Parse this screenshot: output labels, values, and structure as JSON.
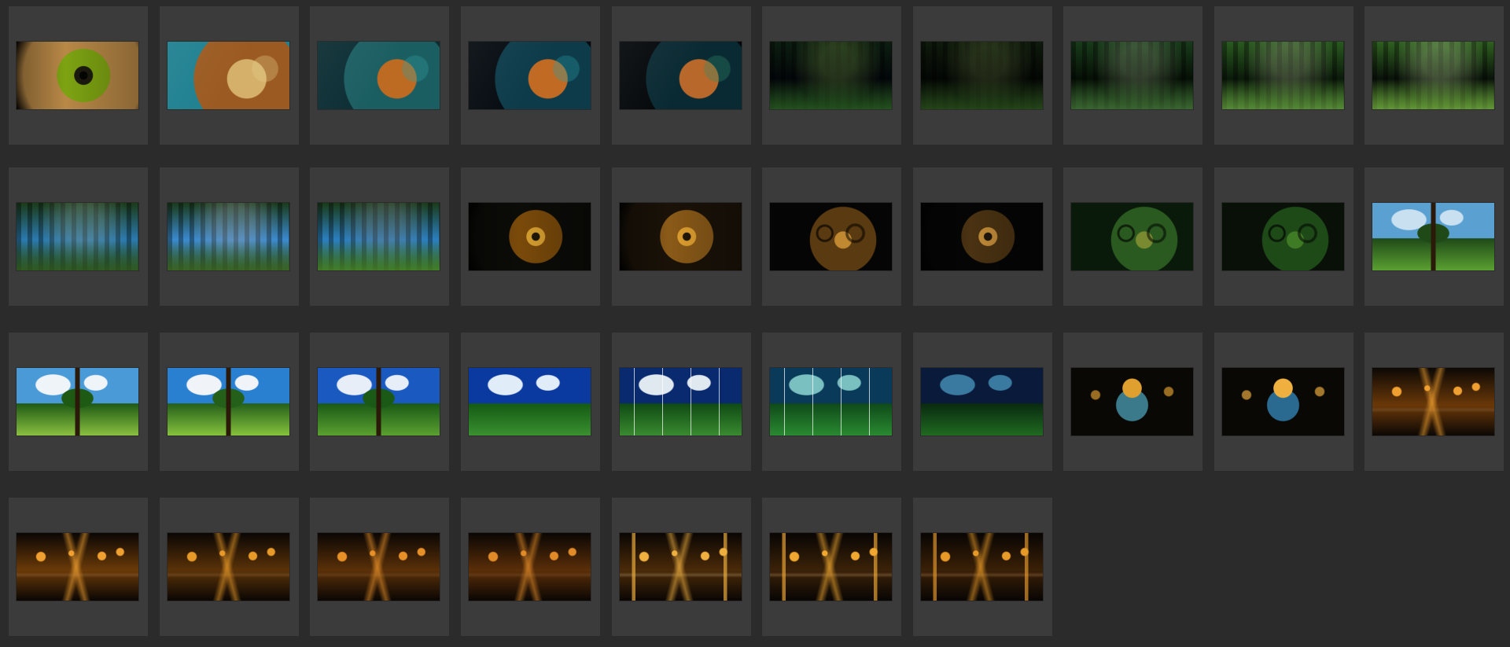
{
  "gallery": {
    "frames": [
      {
        "scene": "eye-closeup-yellow",
        "colors": [
          "#b88846",
          "#7da312",
          "#1b1b10",
          "#d9c8a8"
        ]
      },
      {
        "scene": "hawk-head",
        "colors": [
          "#1e8090",
          "#9b5a21",
          "#d4b06a",
          "#e6d08a"
        ]
      },
      {
        "scene": "bird-portrait-teal",
        "colors": [
          "#0b2d33",
          "#1b5e62",
          "#bd6a22",
          "#2f9fa0"
        ]
      },
      {
        "scene": "bird-on-dark-teal",
        "colors": [
          "#050b10",
          "#0d3b4a",
          "#c06a24",
          "#2aa0a6"
        ]
      },
      {
        "scene": "bird-on-branch",
        "colors": [
          "#05080b",
          "#0a2a33",
          "#b8682a",
          "#2f8a6a"
        ]
      },
      {
        "scene": "leaves-dark",
        "colors": [
          "#03060a",
          "#0c1e10",
          "#2f6a25",
          "#6a8a40"
        ]
      },
      {
        "scene": "forest-dark",
        "colors": [
          "#040704",
          "#0f1a0c",
          "#2f5a20",
          "#5a6b3a"
        ]
      },
      {
        "scene": "forest-creek",
        "colors": [
          "#061006",
          "#183b1a",
          "#4a7a3a",
          "#8a9a7a"
        ]
      },
      {
        "scene": "forest-sunlit",
        "colors": [
          "#0b1a0a",
          "#2a5a20",
          "#6aa040",
          "#9aa080"
        ]
      },
      {
        "scene": "forest-light-rays",
        "colors": [
          "#0a120a",
          "#2f6020",
          "#7ab040",
          "#b0c890"
        ]
      },
      {
        "scene": "forest-road-blue-sky",
        "colors": [
          "#2a7ab0",
          "#1b3a18",
          "#3a6a28",
          "#8a9a8a"
        ]
      },
      {
        "scene": "forest-path",
        "colors": [
          "#3a8ad0",
          "#1a3a1a",
          "#4a7a2a",
          "#a0a0a0"
        ]
      },
      {
        "scene": "forest-clearing",
        "colors": [
          "#2b7fc0",
          "#1a3a18",
          "#58a030",
          "#7a7a7a"
        ]
      },
      {
        "scene": "eye-forest-reflection",
        "colors": [
          "#0b0b08",
          "#7a4a0a",
          "#d8a030",
          "#3a8a40"
        ]
      },
      {
        "scene": "owl-eye-closeup",
        "colors": [
          "#1a1208",
          "#8a5a18",
          "#e0a030",
          "#4a7a40"
        ]
      },
      {
        "scene": "owl-face-dark",
        "colors": [
          "#050505",
          "#5a3a10",
          "#c08830",
          "#6a8a40"
        ]
      },
      {
        "scene": "owl-face-yellow-eyes",
        "colors": [
          "#050505",
          "#4a3212",
          "#c08a38",
          "#d8d020"
        ]
      },
      {
        "scene": "owl-in-tree",
        "colors": [
          "#0a1a0a",
          "#2a5a20",
          "#7a8a30",
          "#a06a20"
        ]
      },
      {
        "scene": "tree-hollow-owl",
        "colors": [
          "#081008",
          "#1e4a18",
          "#3f7a25",
          "#8a5a20"
        ]
      },
      {
        "scene": "big-tree-field",
        "colors": [
          "#5aa0d0",
          "#1f4a18",
          "#5aa030",
          "#c8e0f0"
        ]
      },
      {
        "scene": "tree-meadow-clouds",
        "colors": [
          "#4a9ad8",
          "#1f5a14",
          "#8ac040",
          "#eef4f8"
        ]
      },
      {
        "scene": "tree-meadow-wide",
        "colors": [
          "#2a80d0",
          "#25601a",
          "#86c23c",
          "#f0f4f8"
        ]
      },
      {
        "scene": "small-tree-meadow",
        "colors": [
          "#1a5ac0",
          "#1a5a16",
          "#5aa030",
          "#e8eef8"
        ]
      },
      {
        "scene": "meadow-sunburst",
        "colors": [
          "#0a3aa0",
          "#145a14",
          "#3a9030",
          "#e0ecf8"
        ]
      },
      {
        "scene": "wind-turbines-field",
        "colors": [
          "#0a2a70",
          "#0f4a14",
          "#3a8a30",
          "#e0e8f0"
        ]
      },
      {
        "scene": "turbines-teal-sky",
        "colors": [
          "#0a3a5a",
          "#0f4a1a",
          "#2a8a30",
          "#7ac0c0"
        ]
      },
      {
        "scene": "dark-field-horizon",
        "colors": [
          "#0a1a3a",
          "#0a2a10",
          "#1f6a20",
          "#3a7aa0"
        ]
      },
      {
        "scene": "lightbulb-glow",
        "colors": [
          "#0a0805",
          "#5a3a0a",
          "#e0a030",
          "#3a7a8a"
        ]
      },
      {
        "scene": "bulb-street-lights",
        "colors": [
          "#0a0805",
          "#5a3208",
          "#f0b040",
          "#2a6a90"
        ]
      },
      {
        "scene": "boulevard-lights",
        "colors": [
          "#0c0805",
          "#6a3808",
          "#f0a030",
          "#8a6a40"
        ]
      },
      {
        "scene": "night-avenue-lights",
        "colors": [
          "#0a0604",
          "#6a3a08",
          "#f0a030",
          "#a07040"
        ]
      },
      {
        "scene": "night-avenue-trees",
        "colors": [
          "#0a0604",
          "#5a3208",
          "#e89a28",
          "#9a6a38"
        ]
      },
      {
        "scene": "night-road-trees",
        "colors": [
          "#0a0604",
          "#5a3008",
          "#e89028",
          "#8a5a30"
        ]
      },
      {
        "scene": "night-street-glow",
        "colors": [
          "#0a0604",
          "#5a2e08",
          "#e08a28",
          "#8a5a30"
        ]
      },
      {
        "scene": "christmas-trees-street",
        "colors": [
          "#0a0604",
          "#4a2a08",
          "#f0b040",
          "#c0a070"
        ]
      },
      {
        "scene": "christmas-trees-lights",
        "colors": [
          "#080504",
          "#3a2208",
          "#f0a830",
          "#c09060"
        ]
      },
      {
        "scene": "christmas-trees-night",
        "colors": [
          "#080504",
          "#3a2006",
          "#e89a28",
          "#b08050"
        ]
      }
    ]
  }
}
